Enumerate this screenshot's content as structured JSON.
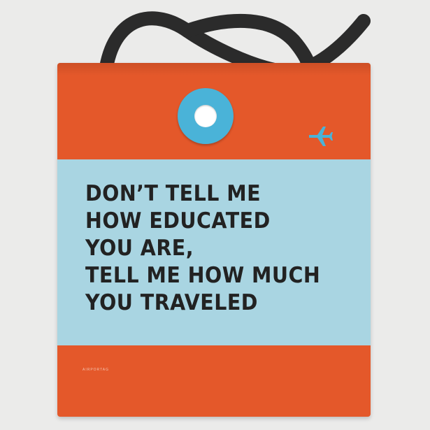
{
  "colors": {
    "background": "#ebebea",
    "bag_orange": "#e4582a",
    "band_blue": "#a9d5e2",
    "ring_blue": "#4ab3d8",
    "plane_blue": "#4ab3d8",
    "strap": "#2b2b2b",
    "text": "#222222"
  },
  "quote_lines": [
    "DON’T TELL ME",
    "HOW EDUCATED",
    "YOU ARE,",
    "TELL ME HOW MUCH",
    "YOU TRAVELED"
  ],
  "brand_mark": "AIRPORTAG",
  "icons": {
    "plane": "airplane-icon",
    "tag_hole": "tag-eyelet"
  }
}
